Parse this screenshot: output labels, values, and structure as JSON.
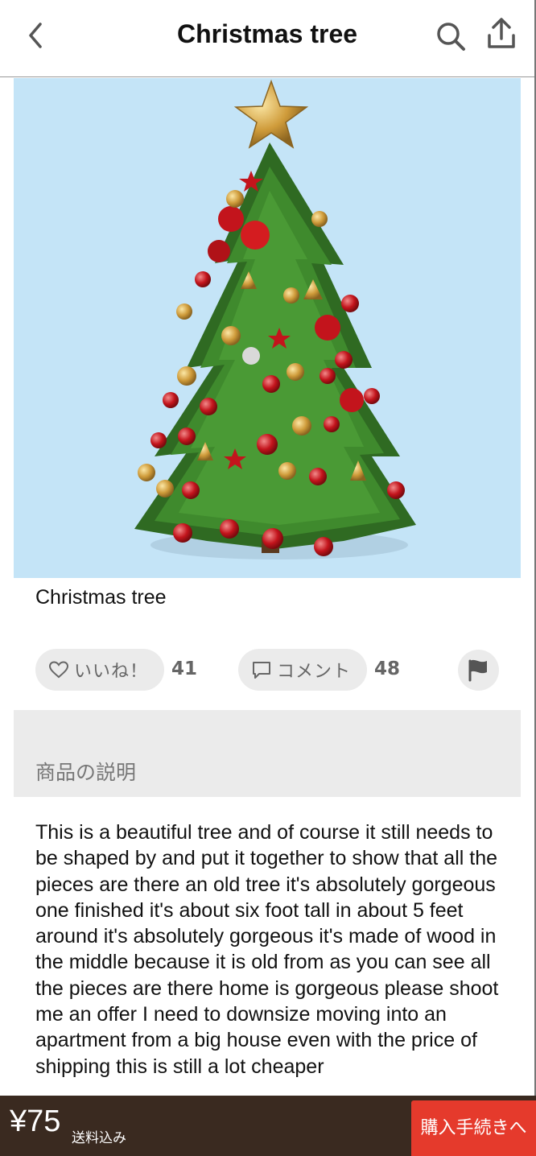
{
  "header": {
    "title": "Christmas tree",
    "back_icon": "chevron-left-icon",
    "search_icon": "search-icon",
    "share_icon": "share-icon"
  },
  "item": {
    "title": "Christmas tree",
    "photo_background": "#c4e4f7"
  },
  "actions": {
    "like_label": "いいね！",
    "like_count": "41",
    "comment_label": "コメント",
    "comment_count": "48",
    "report_icon": "flag-icon"
  },
  "description": {
    "heading": "商品の説明",
    "text": "This is a beautiful tree and of course it still needs to be shaped by and put it together to show that all the pieces are there an old tree it's absolutely gorgeous one finished it's about six foot tall in about 5 feet around it's absolutely gorgeous it's made of wood in the middle because it is old from as you can see all the pieces are there home is gorgeous please shoot me an offer I need to downsize moving into an apartment from a big house even with the price of shipping this is still a lot cheaper"
  },
  "purchase": {
    "price": "¥75",
    "shipping_note": "送料込み",
    "buy_label": "購入手続きへ"
  },
  "colors": {
    "bottom_bar": "#3a2a20",
    "buy_button": "#e53a2c",
    "pill_background": "#ebebeb"
  }
}
